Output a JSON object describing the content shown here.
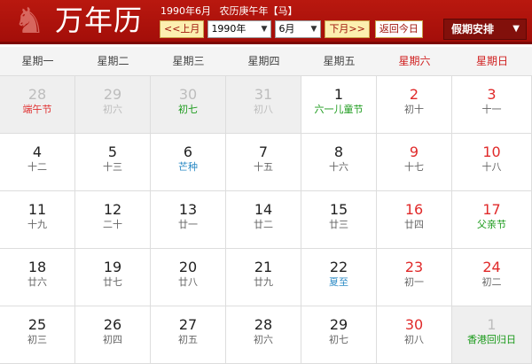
{
  "header": {
    "app_title": "万年历",
    "date_line": "1990年6月",
    "lunar_line": "农历庚午年【马】",
    "prev_month": "<<上月",
    "year_value": "1990年",
    "month_value": "6月",
    "next_month": "下月>>",
    "today_button": "返回今日",
    "holiday_button": "假期安排",
    "horse_glyph": "♞"
  },
  "weekdays": [
    "星期一",
    "星期二",
    "星期三",
    "星期四",
    "星期五",
    "星期六",
    "星期日"
  ],
  "days": [
    {
      "num": "28",
      "lunar": "端午节",
      "style": "fest-red",
      "other": true,
      "weekend": false
    },
    {
      "num": "29",
      "lunar": "初六",
      "style": "",
      "other": true,
      "weekend": false
    },
    {
      "num": "30",
      "lunar": "初七",
      "style": "fest-green",
      "other": true,
      "weekend": false
    },
    {
      "num": "31",
      "lunar": "初八",
      "style": "",
      "other": true,
      "weekend": false
    },
    {
      "num": "1",
      "lunar": "六一儿童节",
      "style": "fest-green",
      "other": false,
      "weekend": false
    },
    {
      "num": "2",
      "lunar": "初十",
      "style": "",
      "other": false,
      "weekend": true
    },
    {
      "num": "3",
      "lunar": "十一",
      "style": "",
      "other": false,
      "weekend": true
    },
    {
      "num": "4",
      "lunar": "十二",
      "style": "",
      "other": false,
      "weekend": false
    },
    {
      "num": "5",
      "lunar": "十三",
      "style": "",
      "other": false,
      "weekend": false
    },
    {
      "num": "6",
      "lunar": "芒种",
      "style": "term-blue",
      "other": false,
      "weekend": false
    },
    {
      "num": "7",
      "lunar": "十五",
      "style": "",
      "other": false,
      "weekend": false
    },
    {
      "num": "8",
      "lunar": "十六",
      "style": "",
      "other": false,
      "weekend": false
    },
    {
      "num": "9",
      "lunar": "十七",
      "style": "",
      "other": false,
      "weekend": true
    },
    {
      "num": "10",
      "lunar": "十八",
      "style": "",
      "other": false,
      "weekend": true
    },
    {
      "num": "11",
      "lunar": "十九",
      "style": "",
      "other": false,
      "weekend": false
    },
    {
      "num": "12",
      "lunar": "二十",
      "style": "",
      "other": false,
      "weekend": false
    },
    {
      "num": "13",
      "lunar": "廿一",
      "style": "",
      "other": false,
      "weekend": false
    },
    {
      "num": "14",
      "lunar": "廿二",
      "style": "",
      "other": false,
      "weekend": false
    },
    {
      "num": "15",
      "lunar": "廿三",
      "style": "",
      "other": false,
      "weekend": false
    },
    {
      "num": "16",
      "lunar": "廿四",
      "style": "",
      "other": false,
      "weekend": true
    },
    {
      "num": "17",
      "lunar": "父亲节",
      "style": "fest-green",
      "other": false,
      "weekend": true
    },
    {
      "num": "18",
      "lunar": "廿六",
      "style": "",
      "other": false,
      "weekend": false
    },
    {
      "num": "19",
      "lunar": "廿七",
      "style": "",
      "other": false,
      "weekend": false
    },
    {
      "num": "20",
      "lunar": "廿八",
      "style": "",
      "other": false,
      "weekend": false
    },
    {
      "num": "21",
      "lunar": "廿九",
      "style": "",
      "other": false,
      "weekend": false
    },
    {
      "num": "22",
      "lunar": "夏至",
      "style": "term-blue",
      "other": false,
      "weekend": false
    },
    {
      "num": "23",
      "lunar": "初一",
      "style": "",
      "other": false,
      "weekend": true
    },
    {
      "num": "24",
      "lunar": "初二",
      "style": "",
      "other": false,
      "weekend": true
    },
    {
      "num": "25",
      "lunar": "初三",
      "style": "",
      "other": false,
      "weekend": false
    },
    {
      "num": "26",
      "lunar": "初四",
      "style": "",
      "other": false,
      "weekend": false
    },
    {
      "num": "27",
      "lunar": "初五",
      "style": "",
      "other": false,
      "weekend": false
    },
    {
      "num": "28",
      "lunar": "初六",
      "style": "",
      "other": false,
      "weekend": false
    },
    {
      "num": "29",
      "lunar": "初七",
      "style": "",
      "other": false,
      "weekend": false
    },
    {
      "num": "30",
      "lunar": "初八",
      "style": "",
      "other": false,
      "weekend": true
    },
    {
      "num": "1",
      "lunar": "香港回归日",
      "style": "fest-green",
      "other": true,
      "weekend": false
    }
  ],
  "colors": {
    "header_red": "#b9180f",
    "weekend_red": "#e02a2a",
    "festival_green": "#1a9a1a",
    "solar_term_blue": "#2b8ac5"
  }
}
